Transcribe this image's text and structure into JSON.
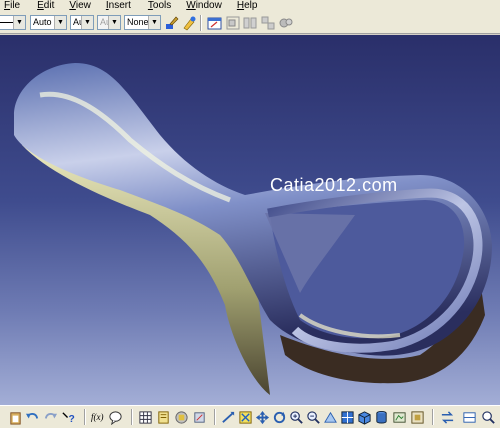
{
  "menu": {
    "items": [
      {
        "label": "File",
        "hotkey": "F",
        "rest": "ile"
      },
      {
        "label": "Edit",
        "hotkey": "E",
        "rest": "dit"
      },
      {
        "label": "View",
        "hotkey": "V",
        "rest": "iew"
      },
      {
        "label": "Insert",
        "hotkey": "I",
        "rest": "nsert"
      },
      {
        "label": "Tools",
        "hotkey": "T",
        "rest": "ools"
      },
      {
        "label": "Window",
        "hotkey": "W",
        "rest": "indow"
      },
      {
        "label": "Help",
        "hotkey": "H",
        "rest": "elp"
      }
    ]
  },
  "toolbar": {
    "color_combo": "Auto",
    "thickness_combo": "Aut",
    "linetype_combo": "Aut",
    "layer_combo": "None"
  },
  "viewport": {
    "watermark": "Catia2012.com",
    "background_top": "#2a2f6a",
    "background_bottom": "#a3aed6"
  },
  "bottombar": {
    "formula_label": "f(x)"
  },
  "icons": [
    "paint-icon",
    "properties-icon",
    "sketch-icon",
    "part-icon",
    "analysis-icon",
    "undo-icon",
    "redo-icon",
    "help-icon",
    "formula-icon",
    "comment-icon",
    "table-icon",
    "catalog-icon",
    "fly-mode-icon",
    "fit-all-icon",
    "pan-icon",
    "rotate-icon",
    "zoom-in-icon",
    "zoom-out-icon",
    "normal-view-icon",
    "iso-view-icon",
    "shading-icon",
    "hide-show-icon",
    "swap-icon"
  ]
}
